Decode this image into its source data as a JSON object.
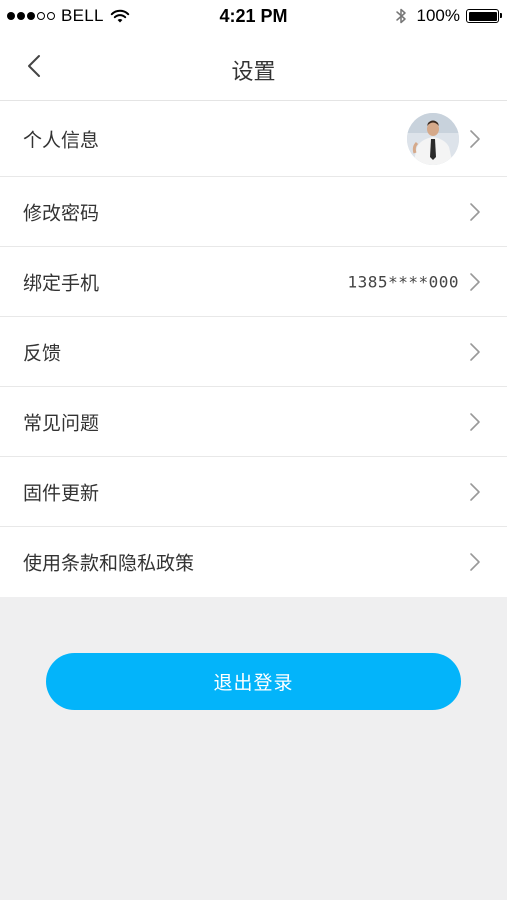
{
  "status_bar": {
    "carrier": "BELL",
    "time": "4:21 PM",
    "battery": "100%",
    "battery_level": 1.0,
    "icons": [
      "signal-dots",
      "wifi-icon",
      "bluetooth-icon",
      "battery-icon"
    ]
  },
  "nav": {
    "title": "设置",
    "back_icon": "chevron-left-icon"
  },
  "settings": {
    "items": [
      {
        "label": "个人信息",
        "type": "avatar",
        "icon": "chevron-right-icon"
      },
      {
        "label": "修改密码",
        "type": "plain",
        "icon": "chevron-right-icon"
      },
      {
        "label": "绑定手机",
        "value": "1385****000",
        "type": "value",
        "icon": "chevron-right-icon"
      },
      {
        "label": "反馈",
        "type": "plain",
        "icon": "chevron-right-icon"
      },
      {
        "label": "常见问题",
        "type": "plain",
        "icon": "chevron-right-icon"
      },
      {
        "label": "固件更新",
        "type": "plain",
        "icon": "chevron-right-icon"
      },
      {
        "label": "使用条款和隐私政策",
        "type": "plain",
        "icon": "chevron-right-icon"
      }
    ]
  },
  "logout": {
    "label": "退出登录"
  },
  "colors": {
    "accent": "#03b4fa",
    "background": "#efeff0",
    "surface": "#ffffff",
    "text": "#333333",
    "divider": "#e8e8e8"
  }
}
